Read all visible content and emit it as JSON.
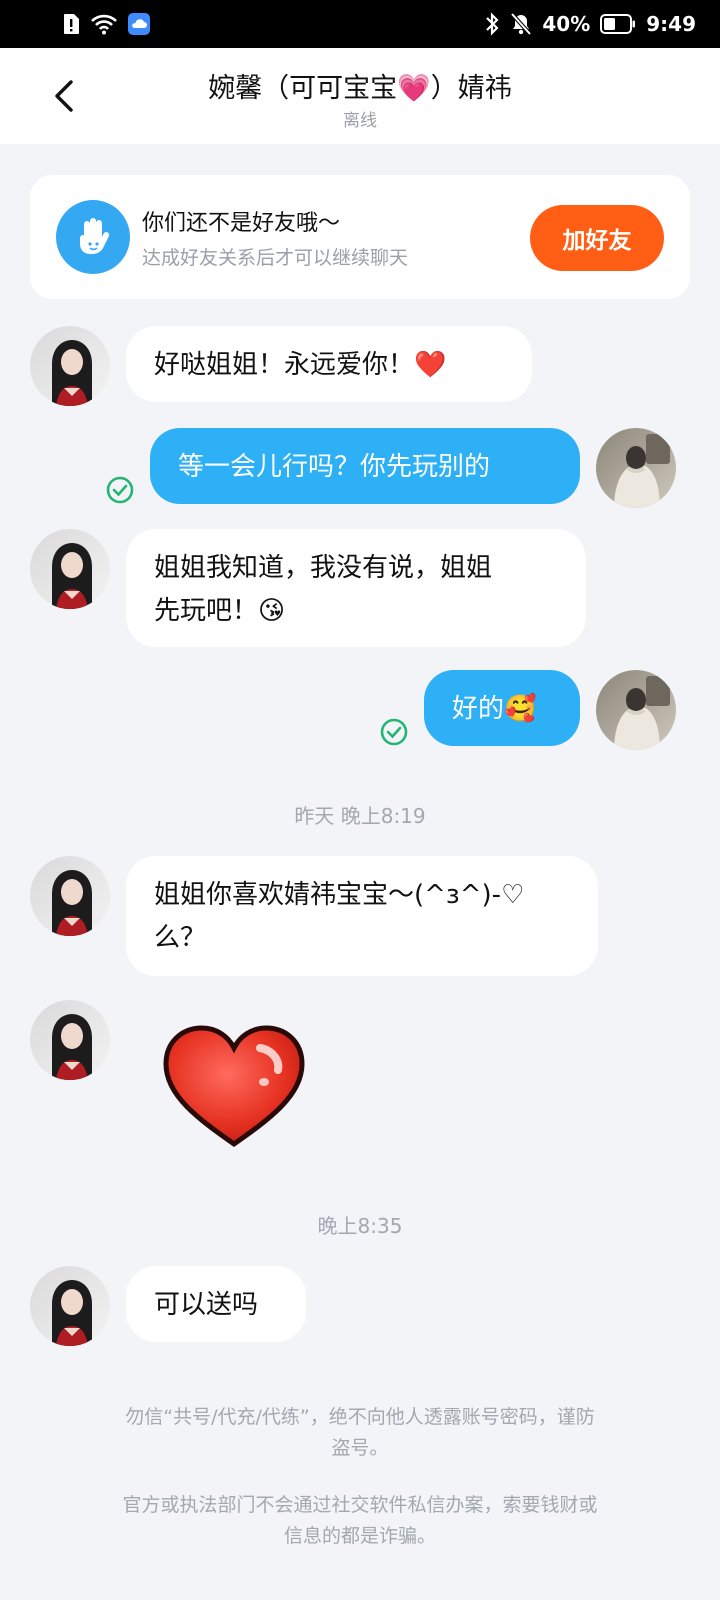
{
  "status_bar": {
    "battery": "40%",
    "time": "9:49",
    "icons": [
      "sim-alert-icon",
      "wifi-icon",
      "cloud-icon",
      "bluetooth-icon",
      "mute-bell-icon",
      "battery-icon"
    ]
  },
  "header": {
    "title": "婉馨（可可宝宝💗）婧祎",
    "status": "离线",
    "back_icon": "chevron-left-icon"
  },
  "friend_prompt": {
    "title": "你们还不是好友哦～",
    "subtitle": "达成好友关系后才可以继续聊天",
    "button": "加好友",
    "icon": "hand-icon",
    "accent": "#ff5e14"
  },
  "messages": [
    {
      "from": "them",
      "text": "好哒姐姐！永远爱你！❤️"
    },
    {
      "from": "me",
      "text": "等一会儿行吗？你先玩别的"
    },
    {
      "from": "them",
      "text_line1": "姐姐我知道，我没有说，姐姐",
      "text_line2": "先玩吧！😘"
    },
    {
      "from": "me",
      "text": "好的🥰"
    },
    {
      "from": "them",
      "text_line1": "姐姐你喜欢婧祎宝宝～(^з^)-♡",
      "text_line2": "么？"
    },
    {
      "from": "them",
      "type": "sticker",
      "sticker": "heart-sticker"
    },
    {
      "from": "them",
      "text": "可以送吗"
    }
  ],
  "timestamps": [
    "昨天 晚上8:19",
    "晚上8:35"
  ],
  "notices": {
    "line1a": "勿信“共号/代充/代练”，绝不向他人透露账号密码，谨防",
    "line1b": "盗号。",
    "line2a": "官方或执法部门不会通过社交软件私信办案，索要钱财或",
    "line2b": "信息的都是诈骗。"
  },
  "colors": {
    "background": "#f2f4f8",
    "outgoing_bubble": "#2db0f5",
    "incoming_bubble": "#ffffff",
    "sent_check": "#22b573"
  }
}
